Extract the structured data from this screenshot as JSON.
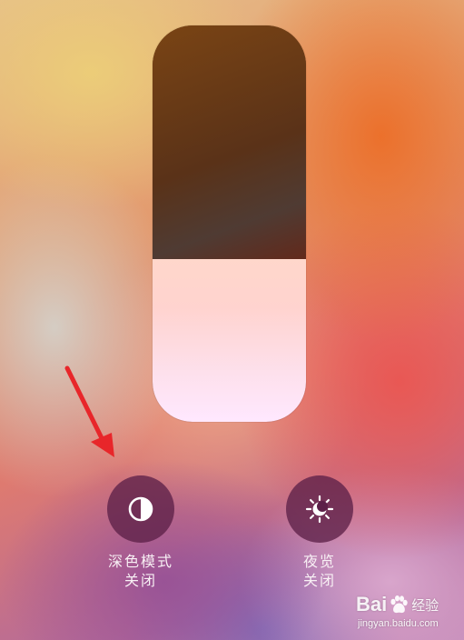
{
  "brightness": {
    "level": 0.41
  },
  "controls": {
    "dark_mode": {
      "label": "深色模式",
      "status": "关闭",
      "icon": "dark-mode-icon"
    },
    "night_shift": {
      "label": "夜览",
      "status": "关闭",
      "icon": "night-shift-icon"
    }
  },
  "annotation": {
    "arrow_color": "#e8262a"
  },
  "watermark": {
    "brand_left": "Bai",
    "brand_right": "经验",
    "url": "jingyan.baidu.com"
  }
}
